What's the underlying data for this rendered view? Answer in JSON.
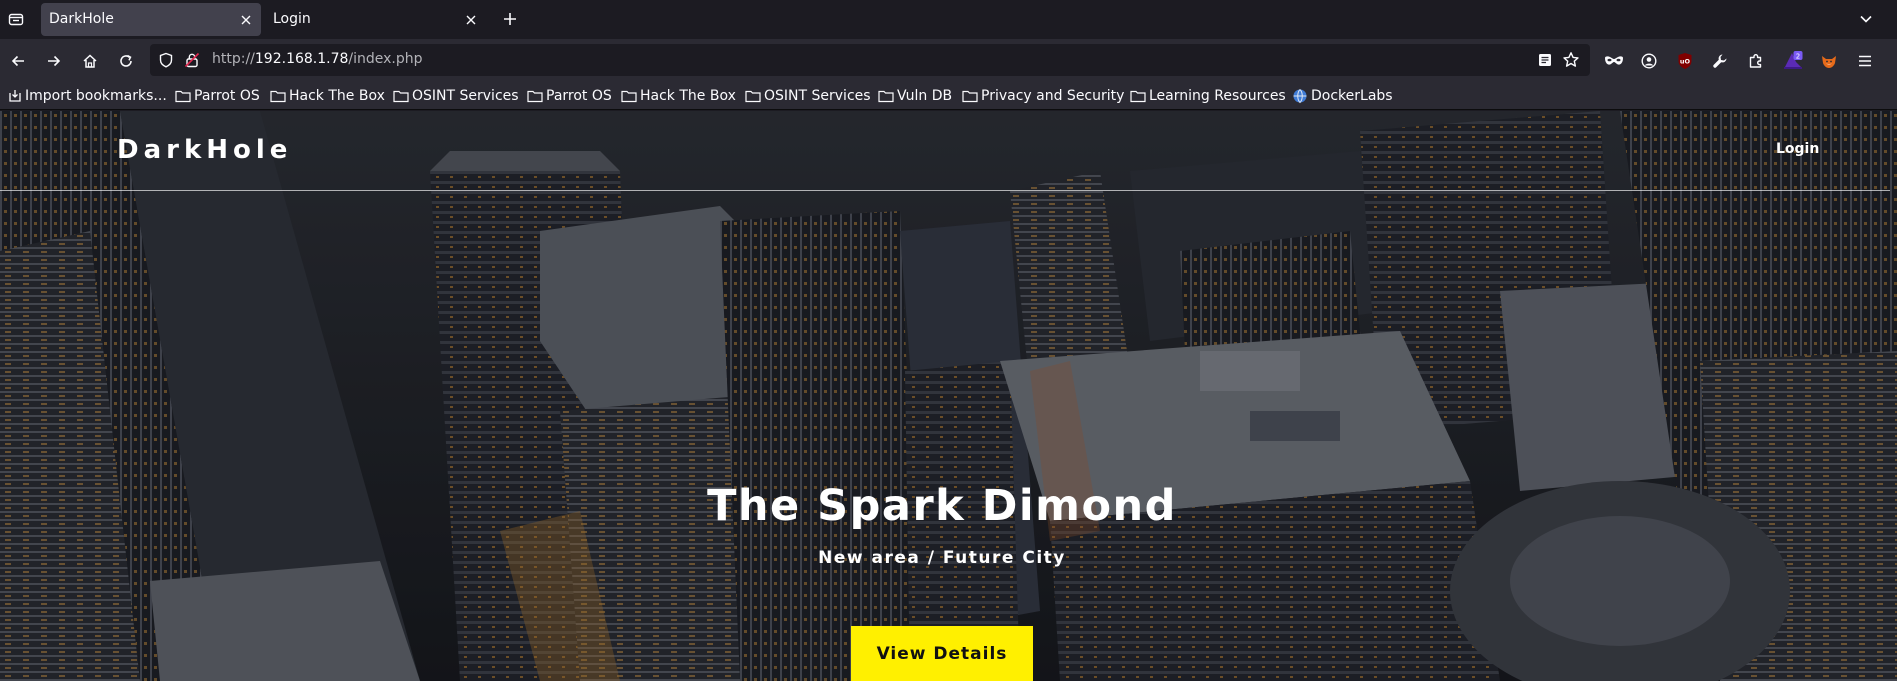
{
  "browser": {
    "tabs": [
      {
        "title": "DarkHole",
        "active": true
      },
      {
        "title": "Login",
        "active": false
      }
    ],
    "url": {
      "scheme": "http://",
      "host": "192.168.1.78",
      "path": "/index.php"
    },
    "extensions_badge": "2",
    "icons": {
      "tab_list": "tab-list-icon",
      "close": "close-icon",
      "new_tab": "plus-icon",
      "overflow": "chevron-down-icon",
      "back": "back-arrow-icon",
      "forward": "forward-arrow-icon",
      "home": "home-icon",
      "reload": "reload-icon",
      "shield": "shield-icon",
      "lock": "insecure-lock-icon",
      "reader": "reader-view-icon",
      "bookmark": "star-icon",
      "private": "mask-icon",
      "account": "account-icon",
      "ublock": "ublock-icon",
      "wrench": "wrench-icon",
      "extensions": "puzzle-icon",
      "wizard": "wizard-hat-icon",
      "foxy": "fox-icon",
      "menu": "hamburger-icon"
    }
  },
  "bookmarks": [
    {
      "label": "Import bookmarks...",
      "icon": "import-icon"
    },
    {
      "label": "Parrot OS",
      "icon": "folder-icon"
    },
    {
      "label": "Hack The Box",
      "icon": "folder-icon"
    },
    {
      "label": "OSINT Services",
      "icon": "folder-icon"
    },
    {
      "label": "Parrot OS",
      "icon": "folder-icon"
    },
    {
      "label": "Hack The Box",
      "icon": "folder-icon"
    },
    {
      "label": "OSINT Services",
      "icon": "folder-icon"
    },
    {
      "label": "Vuln DB",
      "icon": "folder-icon"
    },
    {
      "label": "Privacy and Security",
      "icon": "folder-icon"
    },
    {
      "label": "Learning Resources",
      "icon": "folder-icon"
    },
    {
      "label": "DockerLabs",
      "icon": "globe-icon"
    }
  ],
  "site": {
    "logo": "DarkHole",
    "nav_login": "Login",
    "hero_title": "The Spark Dimond",
    "hero_subtitle": "New area / Future City",
    "hero_button": "View Details",
    "colors": {
      "button_bg": "#fff000",
      "button_text": "#111111",
      "text": "#ffffff"
    }
  }
}
